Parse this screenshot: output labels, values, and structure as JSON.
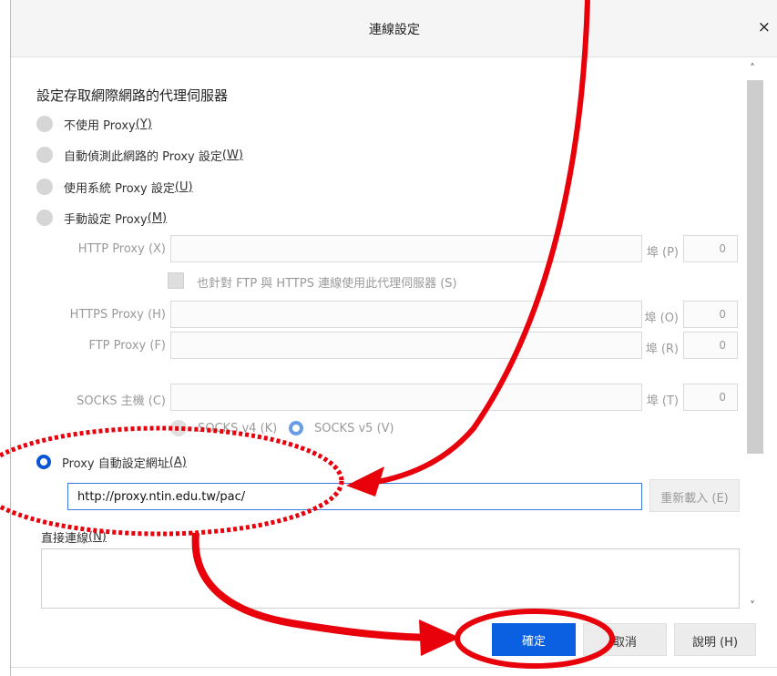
{
  "dialog": {
    "title": "連線設定",
    "close_glyph": "×"
  },
  "section_title": "設定存取網際網路的代理伺服器",
  "options": {
    "no_proxy": {
      "text": "不使用 Proxy ",
      "key": "(Y)"
    },
    "auto_detect": {
      "text": "自動偵測此網路的 Proxy 設定 ",
      "key": "(W)"
    },
    "system": {
      "text": "使用系統 Proxy 設定 ",
      "key": "(U)"
    },
    "manual": {
      "text": "手動設定 Proxy ",
      "key": "(M)"
    },
    "auto_url": {
      "text": "Proxy 自動設定網址 ",
      "key": "(A)"
    }
  },
  "manual": {
    "http_label": "HTTP Proxy (X)",
    "http_port_label": "埠 (P)",
    "http_port": "0",
    "also_use_label": "也針對 FTP 與 HTTPS 連線使用此代理伺服器 (S)",
    "https_label": "HTTPS Proxy (H)",
    "https_port_label": "埠 (O)",
    "https_port": "0",
    "ftp_label": "FTP Proxy (F)",
    "ftp_port_label": "埠 (R)",
    "ftp_port": "0",
    "socks_label": "SOCKS 主機 (C)",
    "socks_port_label": "埠 (T)",
    "socks_port": "0",
    "socks_v4": "SOCKS v4 (K)",
    "socks_v5": "SOCKS v5 (V)"
  },
  "auto_url_value": "http://proxy.ntin.edu.tw/pac/",
  "reload_label": "重新載入 (E)",
  "no_proxy_for": {
    "text": "直接連線 ",
    "key": "(N)"
  },
  "buttons": {
    "ok": "確定",
    "cancel": "取消",
    "help": "說明 (H)"
  },
  "scroll": {
    "up_icon": "˄",
    "down_icon": "˅"
  },
  "colors": {
    "accent": "#0a60e0",
    "annotation": "#e8000b"
  }
}
